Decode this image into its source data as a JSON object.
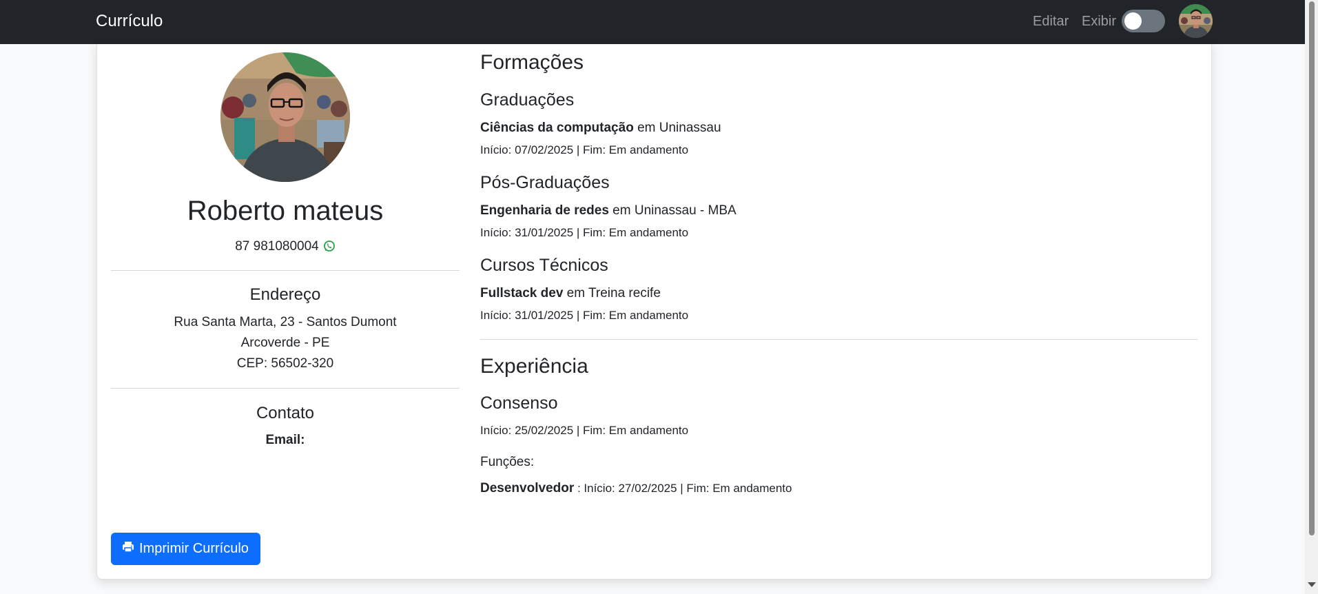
{
  "navbar": {
    "brand": "Currículo",
    "edit_label": "Editar",
    "view_label": "Exibir",
    "toggle_state": "off"
  },
  "profile": {
    "name": "Roberto mateus",
    "phone": "87 981080004",
    "phone_icon": "whatsapp-icon"
  },
  "address": {
    "title": "Endereço",
    "line1": "Rua Santa Marta, 23 - Santos Dumont",
    "line2": "Arcoverde - PE",
    "line3": "CEP: 56502-320"
  },
  "contact": {
    "title": "Contato",
    "email_label": "Email:"
  },
  "print_button": {
    "label": "Imprimir Currículo",
    "icon": "printer-icon"
  },
  "education": {
    "title": "Formações",
    "graduation": {
      "title": "Graduações",
      "course": "Ciências da computação",
      "sep": " em ",
      "institution": "Uninassau",
      "dates": "Início: 07/02/2025 | Fim: Em andamento"
    },
    "postgrad": {
      "title": "Pós-Graduações",
      "course": "Engenharia de redes",
      "sep": " em ",
      "institution": "Uninassau - MBA",
      "dates": "Início: 31/01/2025 | Fim: Em andamento"
    },
    "technical": {
      "title": "Cursos Técnicos",
      "course": "Fullstack dev",
      "sep": " em ",
      "institution": "Treina recife",
      "dates": "Início: 31/01/2025 | Fim: Em andamento"
    }
  },
  "experience": {
    "title": "Experiência",
    "company": "Consenso",
    "dates": "Início: 25/02/2025 | Fim: Em andamento",
    "functions_label": "Funções:",
    "role": "Desenvolvedor",
    "role_dates": " : Início: 27/02/2025 | Fim: Em andamento"
  },
  "colors": {
    "navbar_bg": "#212529",
    "primary": "#0d6efd",
    "whatsapp": "#25a244"
  }
}
